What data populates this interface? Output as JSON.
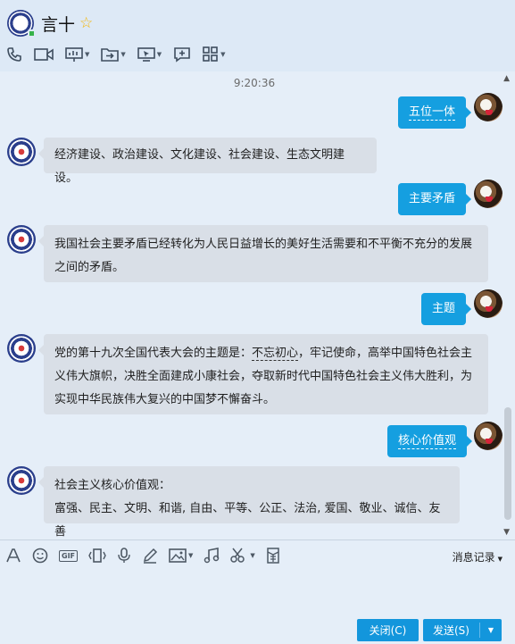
{
  "header": {
    "contact_name": "言十",
    "favorite_icon": "star-icon"
  },
  "toolbar": {
    "items": [
      {
        "name": "voice-call",
        "icon": "phone-icon",
        "has_menu": false
      },
      {
        "name": "video-call",
        "icon": "video-camera-icon",
        "has_menu": false
      },
      {
        "name": "remote-demo",
        "icon": "presentation-icon",
        "has_menu": true
      },
      {
        "name": "send-file",
        "icon": "file-transfer-icon",
        "has_menu": true
      },
      {
        "name": "remote-desktop",
        "icon": "remote-desktop-icon",
        "has_menu": true
      },
      {
        "name": "group-chat",
        "icon": "add-chat-icon",
        "has_menu": false
      },
      {
        "name": "apps",
        "icon": "apps-grid-icon",
        "has_menu": true
      }
    ]
  },
  "chat": {
    "timestamp": "9:20:36",
    "messages": [
      {
        "side": "out",
        "text": "五位一体"
      },
      {
        "side": "in",
        "text": "经济建设、政治建设、文化建设、社会建设、生态文明建设。"
      },
      {
        "side": "out",
        "text": "主要矛盾"
      },
      {
        "side": "in",
        "line1": "我国社会主要矛盾已经转化为人民日益增长的美好生活需要和不平衡不充分的发展",
        "line2": "之间的矛盾。"
      },
      {
        "side": "out",
        "text": "主题"
      },
      {
        "side": "in",
        "l1_a": "党的第十九次全国代表大会的主题是：",
        "l1_b": "不忘初心",
        "l1_c": "，牢记使命，高举中国特色社会主",
        "line2": "义伟大旗帜，决胜全面建成小康社会，夺取新时代中国特色社会主义伟大胜利，为",
        "line3": "实现中华民族伟大复兴的中国梦不懈奋斗。"
      },
      {
        "side": "out",
        "text": "核心价值观"
      },
      {
        "side": "in",
        "line1": "社会主义核心价值观：",
        "line2": "富强、民主、文明、和谐, 自由、平等、公正、法治, 爱国、敬业、诚信、友善"
      }
    ]
  },
  "input": {
    "tools": [
      "font-icon",
      "emoji-icon",
      "gif-icon",
      "shake-icon",
      "voice-icon",
      "pen-icon",
      "image-icon",
      "music-icon",
      "scissors-icon",
      "red-packet-icon"
    ],
    "gif_label": "GIF",
    "history_label": "消息记录",
    "close_label": "关闭(C)",
    "send_label": "发送(S)"
  },
  "colors": {
    "background": "#e5eef8",
    "outgoing_bubble": "#159fe0",
    "incoming_bubble": "#d9dfe7",
    "button": "#1396dc"
  }
}
